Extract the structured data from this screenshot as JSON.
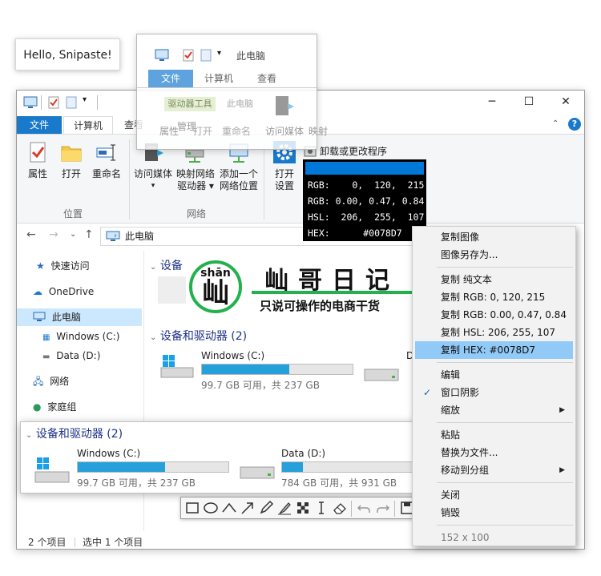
{
  "note": {
    "text": "Hello, Snipaste!"
  },
  "ghost": {
    "title": "此电脑",
    "tabs": [
      "文件",
      "计算机",
      "查看"
    ],
    "context_tab": "驱动器工具",
    "context_tab2": "此电脑",
    "buttons": [
      "属性",
      "管理",
      "打开",
      "重命名",
      "访问媒体",
      "映射"
    ]
  },
  "window": {
    "title_icons": [
      "computer-icon",
      "properties-icon",
      "blank-doc-icon"
    ],
    "tabs": {
      "file": "文件",
      "computer": "计算机",
      "view": "查看"
    },
    "ribbon": {
      "location": {
        "label": "位置",
        "buttons": [
          "属性",
          "打开",
          "重命名"
        ]
      },
      "network": {
        "label": "网络",
        "buttons": [
          {
            "l1": "访问媒体",
            "l2": ""
          },
          {
            "l1": "映射网络",
            "l2": "驱动器"
          },
          {
            "l1": "添加一个",
            "l2": "网络位置"
          }
        ]
      },
      "system": {
        "open_l1": "打开",
        "open_l2": "设置",
        "uninstall": "卸载或更改程序"
      }
    },
    "address": {
      "path": "此电脑"
    },
    "nav": {
      "items": [
        "快速访问",
        "OneDrive",
        "此电脑",
        "Windows (C:)",
        "Data (D:)",
        "网络",
        "家庭组"
      ]
    },
    "content": {
      "section_partial": "设备",
      "section": "设备和驱动器 (2)",
      "drives": [
        {
          "name": "Windows (C:)",
          "info": "99.7 GB 可用，共 237 GB",
          "used": 0.58
        },
        {
          "name": "Data (D:)",
          "info": "784 GB 可用，共 931 GB",
          "used": 0.16
        }
      ],
      "third_drive_partial": "D"
    },
    "status": {
      "items": "2 个项目",
      "selected": "选中 1 个项目"
    }
  },
  "color_info": {
    "swatch": "#0078D7",
    "rows": [
      "RGB:    0,  120,  215",
      "RGB: 0.00, 0.47, 0.84",
      "HSL:  206,  255,  107",
      "HEX:      #0078D7"
    ]
  },
  "logo": {
    "pinyin": "shān",
    "glyph": "屾",
    "title": "屾哥日记",
    "slogan": "只说可操作的电商干货"
  },
  "context_menu": {
    "items": [
      {
        "label": "复制图像"
      },
      {
        "label": "图像另存为..."
      },
      {
        "sep": true
      },
      {
        "label": "复制 纯文本"
      },
      {
        "label": "复制 RGB: 0, 120, 215"
      },
      {
        "label": "复制 RGB: 0.00, 0.47, 0.84"
      },
      {
        "label": "复制 HSL: 206, 255, 107"
      },
      {
        "label": "复制 HEX: #0078D7",
        "highlight": true
      },
      {
        "sep": true
      },
      {
        "label": "编辑"
      },
      {
        "label": "窗口阴影",
        "checked": true
      },
      {
        "label": "缩放",
        "submenu": true
      },
      {
        "sep": true
      },
      {
        "label": "粘贴"
      },
      {
        "label": "替换为文件..."
      },
      {
        "label": "移动到分组",
        "submenu": true
      },
      {
        "sep": true
      },
      {
        "label": "关闭"
      },
      {
        "label": "销毁"
      },
      {
        "sep": true
      },
      {
        "label": "152 x 100",
        "disabled": true
      }
    ]
  },
  "panel": {
    "section": "设备和驱动器 (2)",
    "drives": [
      {
        "name": "Windows (C:)",
        "info": "99.7 GB 可用，共 237 GB",
        "used": 0.58
      },
      {
        "name": "Data (D:)",
        "info": "784 GB 可用，共 931 GB",
        "used": 0.16
      }
    ]
  },
  "toolbar": {
    "tools": [
      "rectangle-icon",
      "ellipse-icon",
      "polyline-icon",
      "arrow-icon",
      "pencil-icon",
      "marker-icon",
      "mosaic-icon",
      "text-icon",
      "eraser-icon",
      "undo-icon",
      "redo-icon",
      "save-icon"
    ]
  },
  "colors": {
    "accent": "#1979ca",
    "highlight": "#91c9f7",
    "drive_bar": "#26a0da",
    "selection": "#cce8ff"
  }
}
